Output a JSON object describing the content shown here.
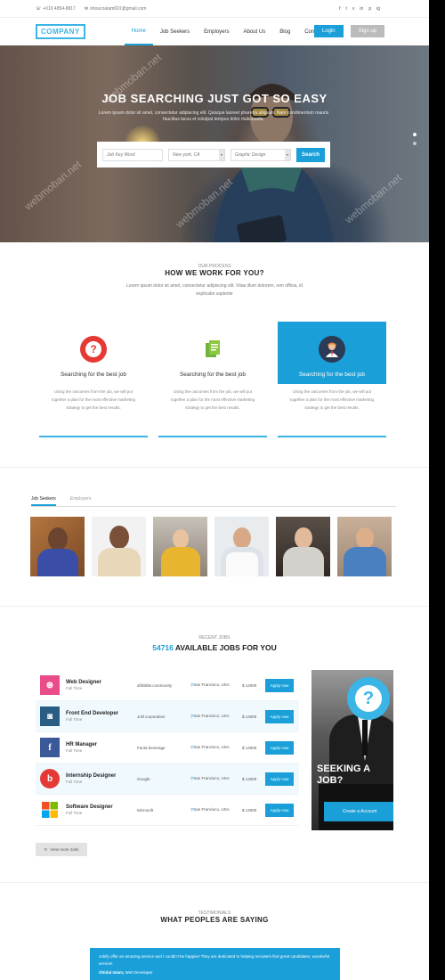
{
  "topbar": {
    "phone": "+019 4854-8817",
    "email": "ohoucoalam691@gmail.com",
    "social": [
      "f",
      "t",
      "v",
      "in",
      "p",
      "ig"
    ]
  },
  "nav": {
    "logo": "COMPANY",
    "items": [
      "Home",
      "Job Seekers",
      "Employers",
      "About Us",
      "Blog",
      "Contact"
    ],
    "active_index": 0,
    "login": "Login",
    "signup": "Sign up"
  },
  "hero": {
    "title": "JOB SEARCHING JUST GOT SO EASY",
    "subtitle": "Lorem ipsum dolor sit amet, consectetur adipiscing elit. Quisque laoreet pharetra aliquam. Nam condimentum mauris faucibus lacus et volutpat tempus dolor malesuada.",
    "keyword_placeholder": "Job Key Word",
    "location": "New york, CA",
    "category": "Graphic Design",
    "search_label": "Search",
    "watermark": "webmoban.net"
  },
  "how": {
    "label": "OUR PROCESS",
    "title": "HOW WE WORK FOR YOU?",
    "desc": "Lorem ipsum dolor sit amet, consectetur adipiscing elit. Vitae illum dolorem, rem officia, id explicabo sapiente",
    "cards": [
      {
        "title": "Searching for the best job",
        "desc": "Using the outcomes from the job, we will put together a plan for the most effective marketing strategy to get the best results."
      },
      {
        "title": "Searching for the best job",
        "desc": "Using the outcomes from the job, we will put together a plan for the most effective marketing strategy to get the best results."
      },
      {
        "title": "Searching for the best job",
        "desc": "Using the outcomes from the job, we will put together a plan for the most effective marketing strategy to get the best results."
      }
    ]
  },
  "people": {
    "tabs": [
      "Job Seekers",
      "Employers"
    ],
    "active_tab": 0
  },
  "jobs": {
    "label": "RECENT JOBS",
    "count": "54716",
    "title_rest": "AVAILABLE JOBS FOR YOU",
    "apply_label": "Apply now",
    "view_more": "View more Jobs",
    "list": [
      {
        "title": "Web Designer",
        "type": "Full Time",
        "company": "dribbble.community",
        "location": "San Francisco, USA",
        "salary": "$ 14000",
        "brand": "#ea4c89"
      },
      {
        "title": "Front End Developer",
        "type": "Full Time",
        "company": "Jolil corporation",
        "location": "San Francisco, USA",
        "salary": "$ 14000",
        "brand": "#2a5d84"
      },
      {
        "title": "HR Manager",
        "type": "Full Time",
        "company": "Fanta beverage",
        "location": "San Francisco, USA",
        "salary": "$ 14000",
        "brand": "#3b5998"
      },
      {
        "title": "Internship Designer",
        "type": "Full Time",
        "company": "Google",
        "location": "San Francisco, USA",
        "salary": "$ 14000",
        "brand": "#e53935"
      },
      {
        "title": "Software Designer",
        "type": "Full Time",
        "company": "Microsoft",
        "location": "San Francisco, USA",
        "salary": "$ 14000",
        "brand": "#ffffff"
      }
    ]
  },
  "seeking": {
    "line1": "SEEKING A",
    "line2": "JOB?",
    "button": "Create a Account"
  },
  "testimonials": {
    "label": "TESTIMONIALS",
    "title": "WHAT PEOPLES ARE SAYING",
    "quote": "Jobify offer an amazing service and I couldn't be happier! They are dedicated to helping recruiters find great candidates, wonderful service!",
    "name": "Ohidul Islam,",
    "role": "Web Developer"
  },
  "colors": {
    "accent": "#1a9fd8",
    "logo_secondary": "#8dc63f"
  }
}
